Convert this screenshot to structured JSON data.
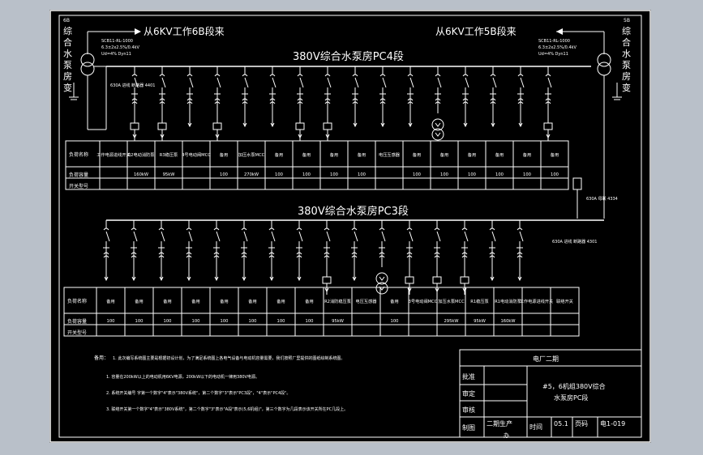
{
  "feeds": {
    "left": "从6KV工作6B段来",
    "right": "从6KV工作5B段来"
  },
  "transformers": {
    "left": {
      "model": "SCB11-RL-1000",
      "spec": "6.3±2x2.5%/0.4kV",
      "ud": "Ud=4% Dyn11",
      "name_chars": [
        "综",
        "合",
        "水",
        "泵",
        "房",
        "变"
      ],
      "prefix": "6B"
    },
    "right": {
      "model": "SCB11-RL-1000",
      "spec": "6.3±2x2.5%/0.4kV",
      "ud": "Ud=4% Dyn11",
      "name_chars": [
        "综",
        "合",
        "水",
        "泵",
        "房",
        "变"
      ],
      "prefix": "5B"
    }
  },
  "bus_top": {
    "title": "380V综合水泵房PC4段",
    "incomer": "630A 进线\n断路器\n4401"
  },
  "bus_bottom": {
    "title": "380V综合水泵房PC3段",
    "incomer": "630A 进线\n断路器\n4301",
    "tie": "630A 母联\n4334"
  },
  "table_top": {
    "row_labels": [
      "负荷名称",
      "负荷容量",
      "开关型号"
    ],
    "loads": [
      "工作电源进线开关",
      "R2电动消防泵",
      "R3稳压泵",
      "4号电动阀MCC",
      "备用",
      "加压水泵MCC",
      "备用",
      "备用",
      "备用",
      "备用",
      "电压互感器",
      "备用",
      "备用",
      "备用",
      "备用",
      "备用",
      "备用"
    ],
    "capacities": [
      "",
      "160kW",
      "95kW",
      "",
      "100",
      "270kW",
      "100",
      "100",
      "100",
      "100",
      "",
      "100",
      "100",
      "100",
      "100",
      "100",
      "100"
    ]
  },
  "table_bottom": {
    "row_labels": [
      "负荷名称",
      "负荷容量",
      "开关型号"
    ],
    "loads": [
      "备用",
      "备用",
      "备用",
      "备用",
      "备用",
      "备用",
      "备用",
      "备用",
      "R2消防稳压泵",
      "电压互感器",
      "备用",
      "3号电动阀MCC",
      "加压水泵MCC",
      "R1稳压泵",
      "R1电动消防泵",
      "工作电源进线开关",
      "联络开关"
    ],
    "capacities": [
      "100",
      "100",
      "100",
      "100",
      "100",
      "100",
      "100",
      "100",
      "95kW",
      "",
      "100",
      "",
      "295kW",
      "95kW",
      "160kW",
      "",
      ""
    ]
  },
  "notes": {
    "heading": "备用：",
    "lines": [
      "1. 此次编写系统图主要是根据初设计划，为了满足系统图上各电气设备与电动机容量需要，我们按照厂里提供的图纸绘制系统图。",
      "1. 容量在200kW以上的电动机用6KV电源，200kW以下的电动机一律用380V电源。",
      "2. 系统开关编号 字第一个数字\"4\"表示\"380V系统\"，第二个数字\"3\"表示\"PC3段\"，\"4\"表示\"PC4段\"。",
      "3. 联络开关第一个数字\"4\"表示\"380V系统\"，第二个数字\"3\"表示\"A段\"表示(5,6机组)\"，第三个数字为几段表示该开关所在PC几段上。"
    ]
  },
  "title_block": {
    "company": "电厂二期",
    "approve": "批准",
    "review": "审定",
    "check": "审核",
    "drawn": "制图",
    "dept": "二期生产",
    "dept2": "办",
    "drawing_title_1": "#5，6机组380V综合",
    "drawing_title_2": "水泵房PC段",
    "time_label": "时间",
    "time_value": "05.1",
    "page_label": "页码",
    "page_value": "电1-019"
  }
}
